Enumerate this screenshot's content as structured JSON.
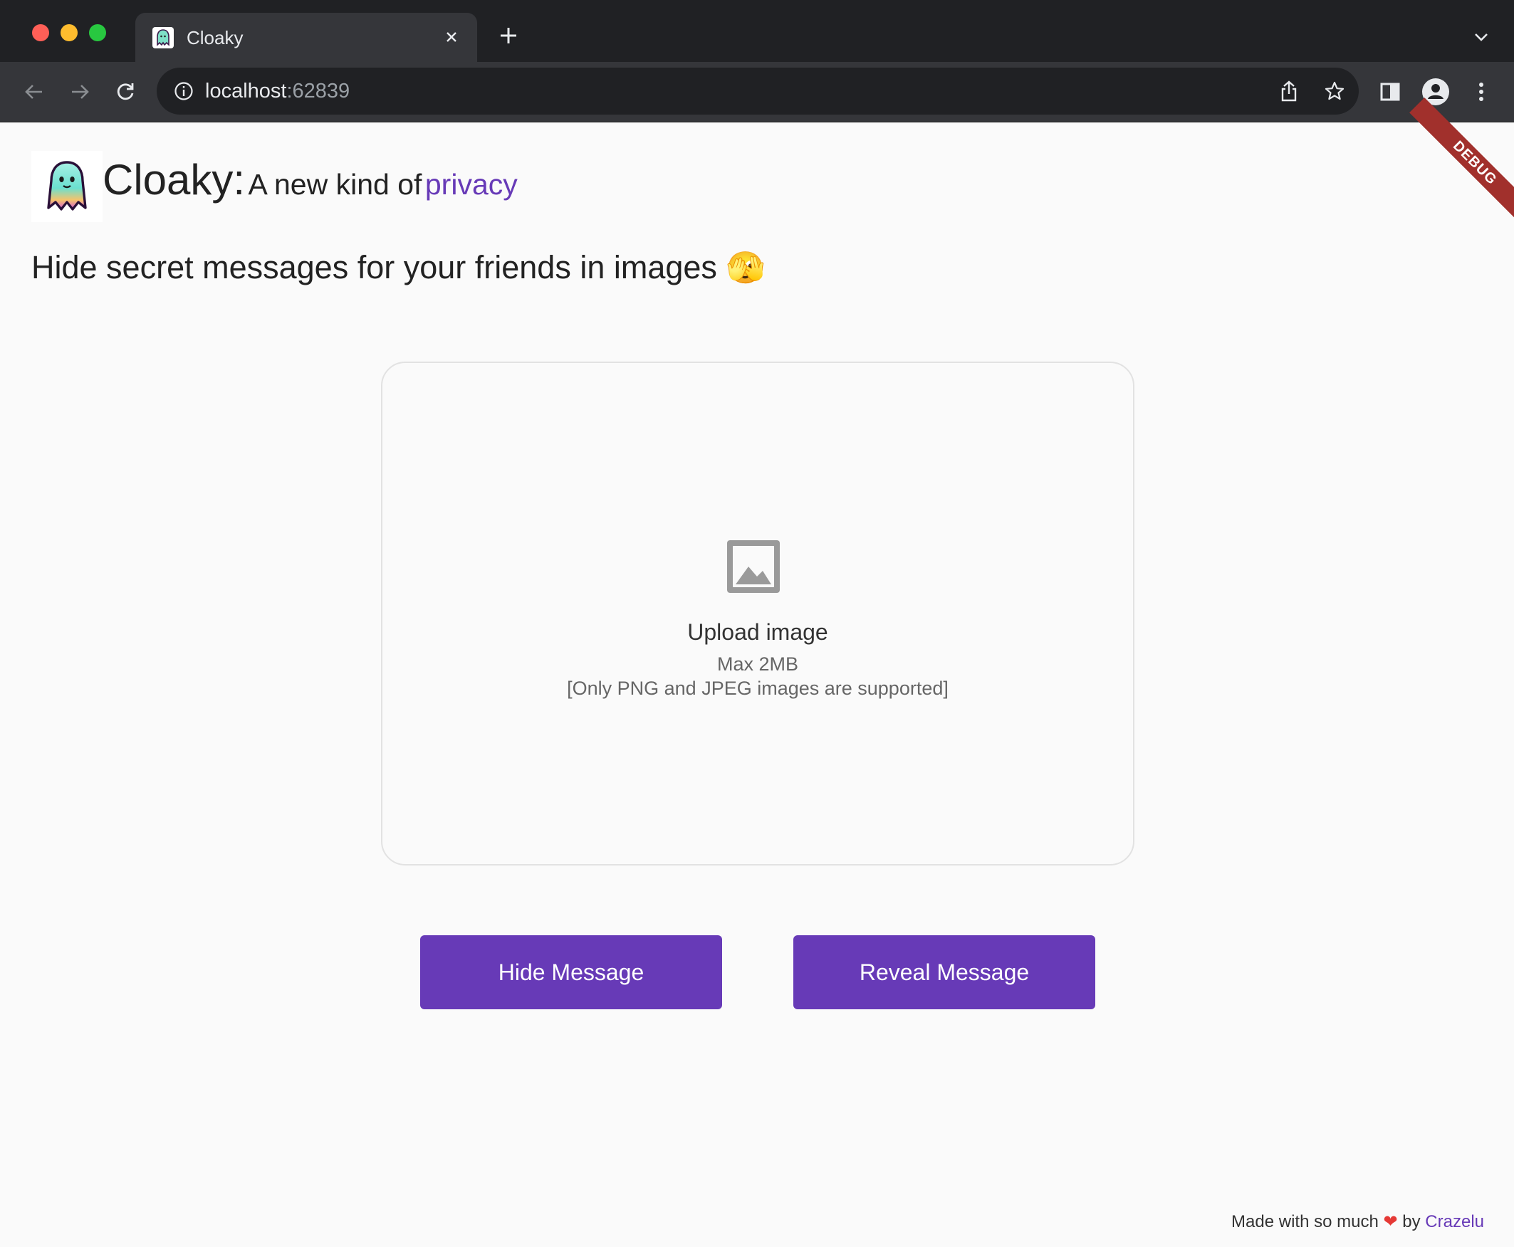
{
  "browser": {
    "tab": {
      "title": "Cloaky",
      "favicon": "ghost-favicon"
    },
    "address": {
      "host": "localhost",
      "port": ":62839"
    },
    "icons": {
      "back": "arrow-left-icon",
      "forward": "arrow-right-icon",
      "reload": "reload-icon",
      "info": "info-icon",
      "share": "share-icon",
      "bookmark": "star-icon",
      "sidepanel": "side-panel-icon",
      "profile": "profile-icon",
      "menu": "kebab-menu-icon"
    }
  },
  "app": {
    "debug_label": "DEBUG",
    "logo": "ghost-logo",
    "brand_name": "Cloaky:",
    "tagline_prefix": "A new kind of",
    "tagline_accent": "privacy",
    "subtitle": "Hide secret messages for your friends in images",
    "subtitle_emoji": "🫣",
    "upload": {
      "icon": "image-icon",
      "title": "Upload image",
      "size_note": "Max 2MB",
      "format_note": "[Only PNG and JPEG images are supported]"
    },
    "actions": {
      "hide_label": "Hide Message",
      "reveal_label": "Reveal Message"
    },
    "footer": {
      "prefix": "Made with so much",
      "heart": "❤",
      "by": "by",
      "author": "Crazelu"
    },
    "colors": {
      "accent": "#673ab7",
      "debug": "#a1302c"
    }
  }
}
